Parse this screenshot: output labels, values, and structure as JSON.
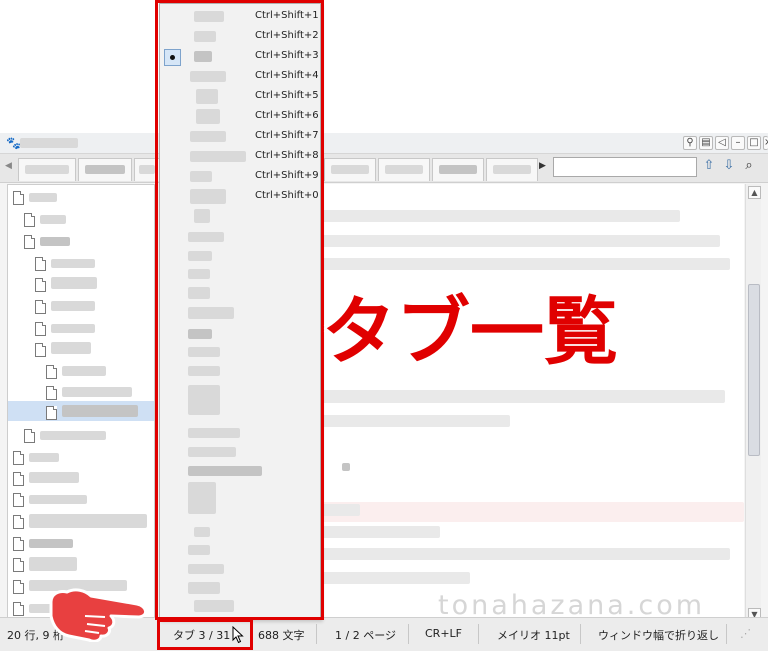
{
  "tab_menu": {
    "shortcuts": [
      "Ctrl+Shift+1",
      "Ctrl+Shift+2",
      "Ctrl+Shift+3",
      "Ctrl+Shift+4",
      "Ctrl+Shift+5",
      "Ctrl+Shift+6",
      "Ctrl+Shift+7",
      "Ctrl+Shift+8",
      "Ctrl+Shift+9",
      "Ctrl+Shift+0"
    ],
    "checked_index": 2
  },
  "status": {
    "position": "20 行, 9 桁",
    "tab": "タブ 3 / 31",
    "chars": "688 文字",
    "page": "1 / 2 ページ",
    "newline": "CR+LF",
    "font": "メイリオ 11pt",
    "wrap": "ウィンドウ幅で折り返し"
  },
  "annotation": {
    "text": "タブ一覧",
    "color": "#e00000"
  },
  "watermark": "tonahazana.com",
  "colors": {
    "highlight_red": "#e00000",
    "selection": "#cfe0f4"
  },
  "icons": [
    "app-paw-icon",
    "up-arrow-icon",
    "down-arrow-icon",
    "search-icon",
    "pointing-hand-icon",
    "mouse-cursor-icon"
  ]
}
